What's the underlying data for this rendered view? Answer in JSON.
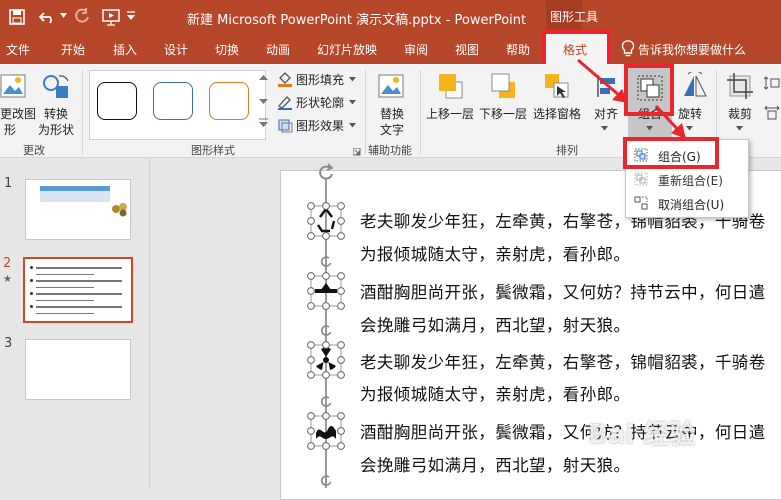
{
  "title_bar": {
    "document_title": "新建 Microsoft PowerPoint 演示文稿.pptx  -  PowerPoint",
    "contextual_group": "图形工具"
  },
  "tabs": [
    "文件",
    "开始",
    "插入",
    "设计",
    "切换",
    "动画",
    "幻灯片放映",
    "审阅",
    "视图",
    "帮助",
    "格式"
  ],
  "tell_me": "告诉我你想要做什么",
  "ribbon": {
    "change_group": {
      "change_shape_1": "更改图",
      "change_shape_2": "形",
      "convert_1": "转换",
      "convert_2": "为形状",
      "label": "更改"
    },
    "shape_styles": {
      "fill": "图形填充",
      "outline": "形状轮廓",
      "effects": "图形效果",
      "label": "图形样式"
    },
    "accessibility": {
      "alt_text_1": "替换",
      "alt_text_2": "文字",
      "label": "辅助功能"
    },
    "arrange": {
      "bring_forward": "上移一层",
      "send_backward": "下移一层",
      "selection_pane": "选择窗格",
      "align": "对齐",
      "group": "组合",
      "rotate": "旋转",
      "label": "排列"
    },
    "size": {
      "crop": "裁剪"
    }
  },
  "group_menu": {
    "items": [
      "组合(G)",
      "重新组合(E)",
      "取消组合(U)"
    ]
  },
  "slides": {
    "numbers": [
      "1",
      "2",
      "3"
    ],
    "active_index": 1
  },
  "slide_content": {
    "lines": [
      "老夫聊发少年狂，左牵黄，右擎苍，锦帽貂裘，千骑卷",
      "为报倾城随太守，亲射虎，看孙郎。",
      "酒酣胸胆尚开张，鬓微霜，又何妨？持节云中，何日遣",
      "会挽雕弓如满月，西北望，射天狼。",
      "老夫聊发少年狂，左牵黄，右擎苍，锦帽貂裘，千骑卷",
      "为报倾城随太守，亲射虎，看孙郎。",
      "酒酣胸胆尚开张，鬓微霜，又何妨？持节云中，何日遣",
      "会挽雕弓如满月，西北望，射天狼。"
    ]
  },
  "watermark": "Bai 经验",
  "colors": {
    "accent": "#b7472a",
    "highlight": "#e8262d"
  }
}
